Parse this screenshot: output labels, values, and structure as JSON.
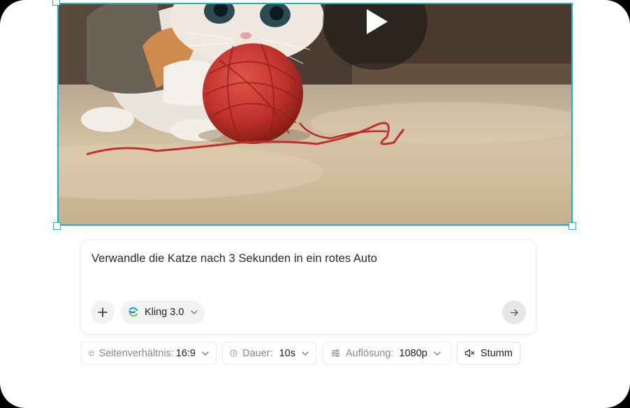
{
  "prompt": {
    "text": "Verwandle die Katze nach 3 Sekunden in ein rotes Auto"
  },
  "model": {
    "label": "Kling 3.0"
  },
  "settings": {
    "aspect": {
      "label": "Seitenverhältnis:",
      "value": "16:9"
    },
    "duration": {
      "label": "Dauer:",
      "value": "10s"
    },
    "resolution": {
      "label": "Auflösung:",
      "value": "1080p"
    },
    "mute": {
      "label": "Stumm"
    }
  },
  "icons": {
    "play": "play-icon",
    "plus": "plus-icon",
    "model": "kling-logo-icon",
    "send": "arrow-right-icon",
    "aspect": "aspect-ratio-icon",
    "duration": "clock-icon",
    "resolution": "sliders-icon",
    "mute": "speaker-muted-icon"
  },
  "colors": {
    "accent": "#1bb3c9",
    "yarn": "#c0312b"
  }
}
